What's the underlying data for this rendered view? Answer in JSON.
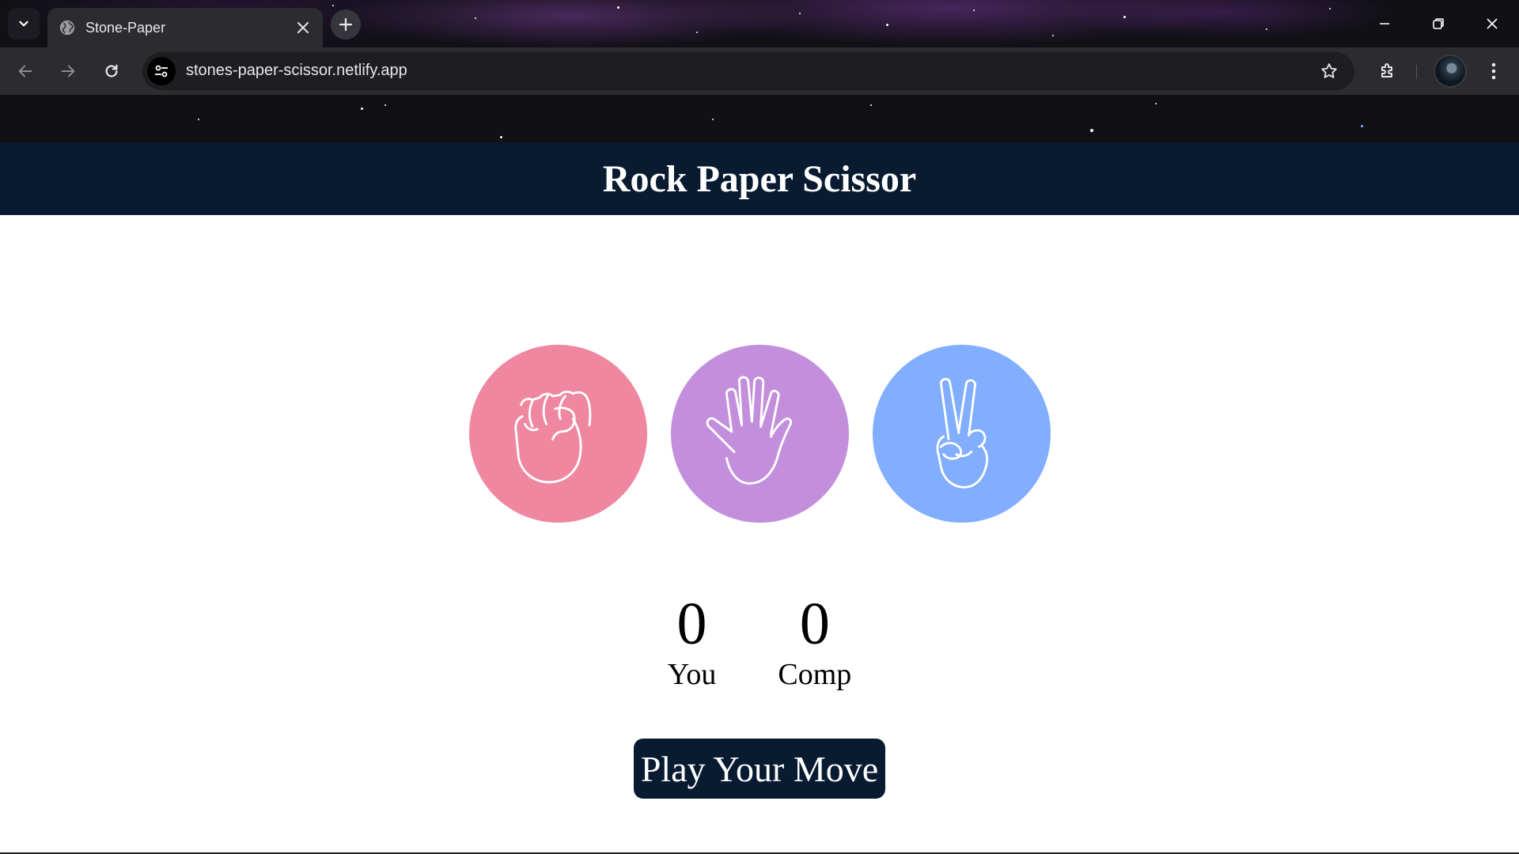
{
  "browser": {
    "tab_title": "Stone-Paper",
    "url": "stones-paper-scissor.netlify.app",
    "icons": {
      "tab_search": "chevron-down-icon",
      "favicon": "globe-icon",
      "tab_close": "close-icon",
      "new_tab": "plus-icon",
      "back": "arrow-left-icon",
      "forward": "arrow-right-icon",
      "reload": "reload-icon",
      "site_info": "tune-icon",
      "bookmark": "star-icon",
      "extensions": "puzzle-icon",
      "menu": "kebab-icon"
    }
  },
  "app": {
    "title": "Rock Paper Scissor",
    "choices": [
      {
        "id": "rock",
        "color": "#ef87a1",
        "icon": "fist-icon"
      },
      {
        "id": "paper",
        "color": "#c38fdd",
        "icon": "open-hand-icon"
      },
      {
        "id": "scissors",
        "color": "#82aeff",
        "icon": "peace-hand-icon"
      }
    ],
    "scores": {
      "user": "0",
      "user_label": "You",
      "comp": "0",
      "comp_label": "Comp"
    },
    "message": "Play Your Move",
    "colors": {
      "header": "#081b31",
      "button": "#081b31"
    }
  }
}
